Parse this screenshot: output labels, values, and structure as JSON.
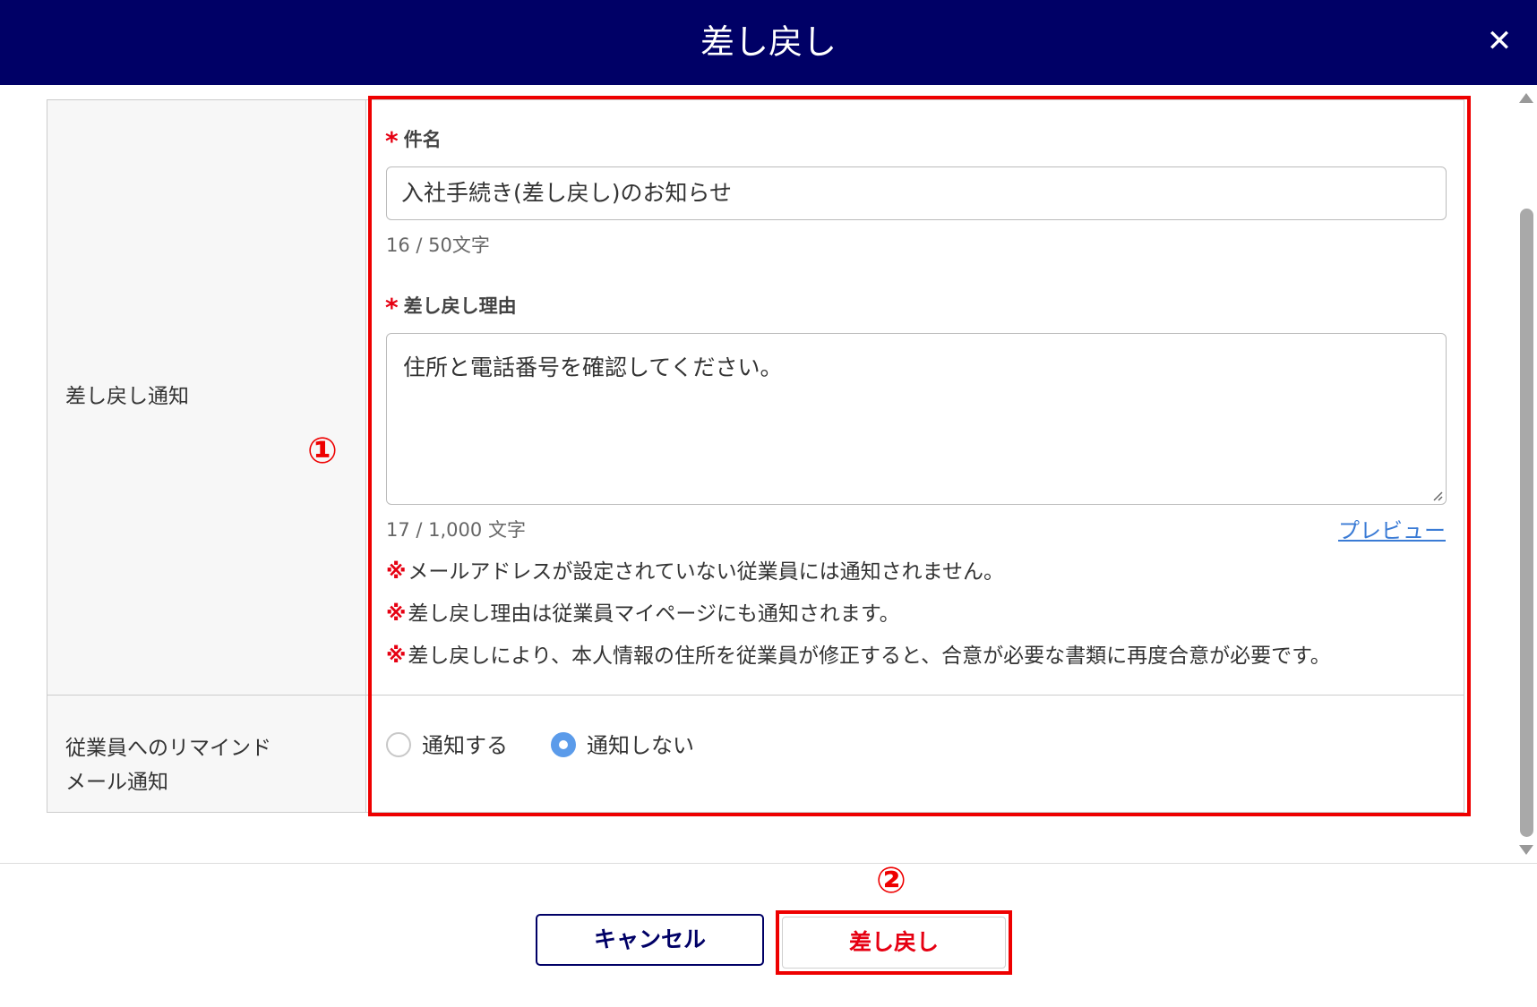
{
  "header": {
    "title": "差し戻し",
    "close_glyph": "✕",
    "close_icon": "close-icon"
  },
  "form": {
    "rows": [
      {
        "label": "差し戻し通知"
      },
      {
        "label_lines": [
          "従業員へのリマインド",
          "メール通知"
        ]
      }
    ],
    "required_mark": "*",
    "subject": {
      "label": "件名",
      "value": "入社手続き(差し戻し)のお知らせ",
      "counter": "16 / 50文字"
    },
    "reason": {
      "label": "差し戻し理由",
      "value": "住所と電話番号を確認してください。",
      "counter": "17 / 1,000 文字",
      "preview_label": "プレビュー"
    },
    "notes": {
      "mark": "※",
      "items": [
        "メールアドレスが設定されていない従業員には通知されません。",
        "差し戻し理由は従業員マイページにも通知されます。",
        "差し戻しにより、本人情報の住所を従業員が修正すると、合意が必要な書類に再度合意が必要です。"
      ]
    },
    "reminder": {
      "options": [
        {
          "label": "通知する",
          "checked": false
        },
        {
          "label": "通知しない",
          "checked": true
        }
      ]
    }
  },
  "footer": {
    "cancel_label": "キャンセル",
    "submit_label": "差し戻し"
  },
  "annotations": {
    "area_1": "①",
    "area_2": "②"
  },
  "colors": {
    "header_bg": "#000066",
    "required": "#e60012",
    "link": "#3a7bd5",
    "radio_checked": "#5b9bea",
    "annotation": "#ee0000"
  }
}
